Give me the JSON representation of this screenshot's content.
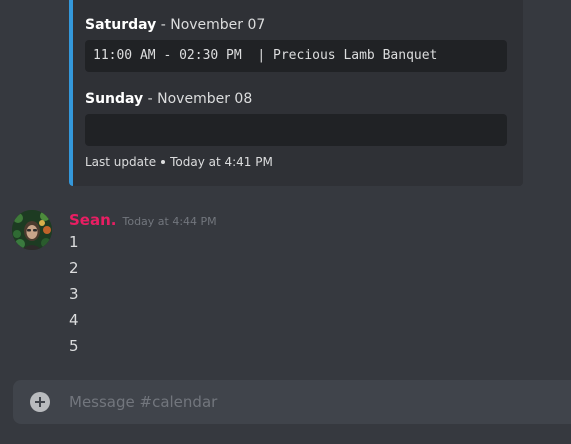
{
  "embed": {
    "accent_color": "#3498db",
    "days": [
      {
        "day": "Saturday",
        "separator": " - ",
        "date": "November 07",
        "entry": "11:00 AM - 02:30 PM  | Precious Lamb Banquet"
      },
      {
        "day": "Sunday",
        "separator": " - ",
        "date": "November 08",
        "entry": ""
      }
    ],
    "footer": {
      "label": "Last update",
      "time": "Today at 4:41 PM"
    }
  },
  "message": {
    "author": "Sean.",
    "author_color": "#e91e63",
    "timestamp": "Today at 4:44 PM",
    "lines": [
      "1",
      "2",
      "3",
      "4",
      "5"
    ]
  },
  "composer": {
    "placeholder": "Message #calendar",
    "add_icon": "plus-circle-icon"
  }
}
